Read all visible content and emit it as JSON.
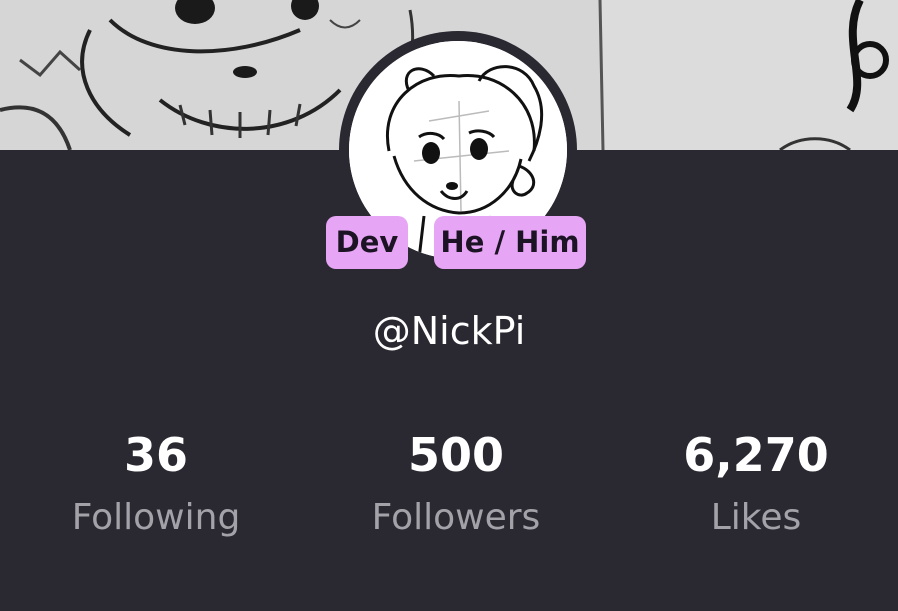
{
  "profile": {
    "username": "@NickPi",
    "badges": {
      "role": "Dev",
      "pronouns": "He / Him"
    }
  },
  "stats": {
    "following": {
      "value": "36",
      "label": "Following"
    },
    "followers": {
      "value": "500",
      "label": "Followers"
    },
    "likes": {
      "value": "6,270",
      "label": "Likes"
    }
  },
  "icons": {
    "banner": "sketch-banner-image",
    "avatar": "sketch-avatar-image"
  },
  "colors": {
    "background": "#2a2831",
    "badge": "#e7a6f5",
    "label": "#a4a2a9"
  }
}
